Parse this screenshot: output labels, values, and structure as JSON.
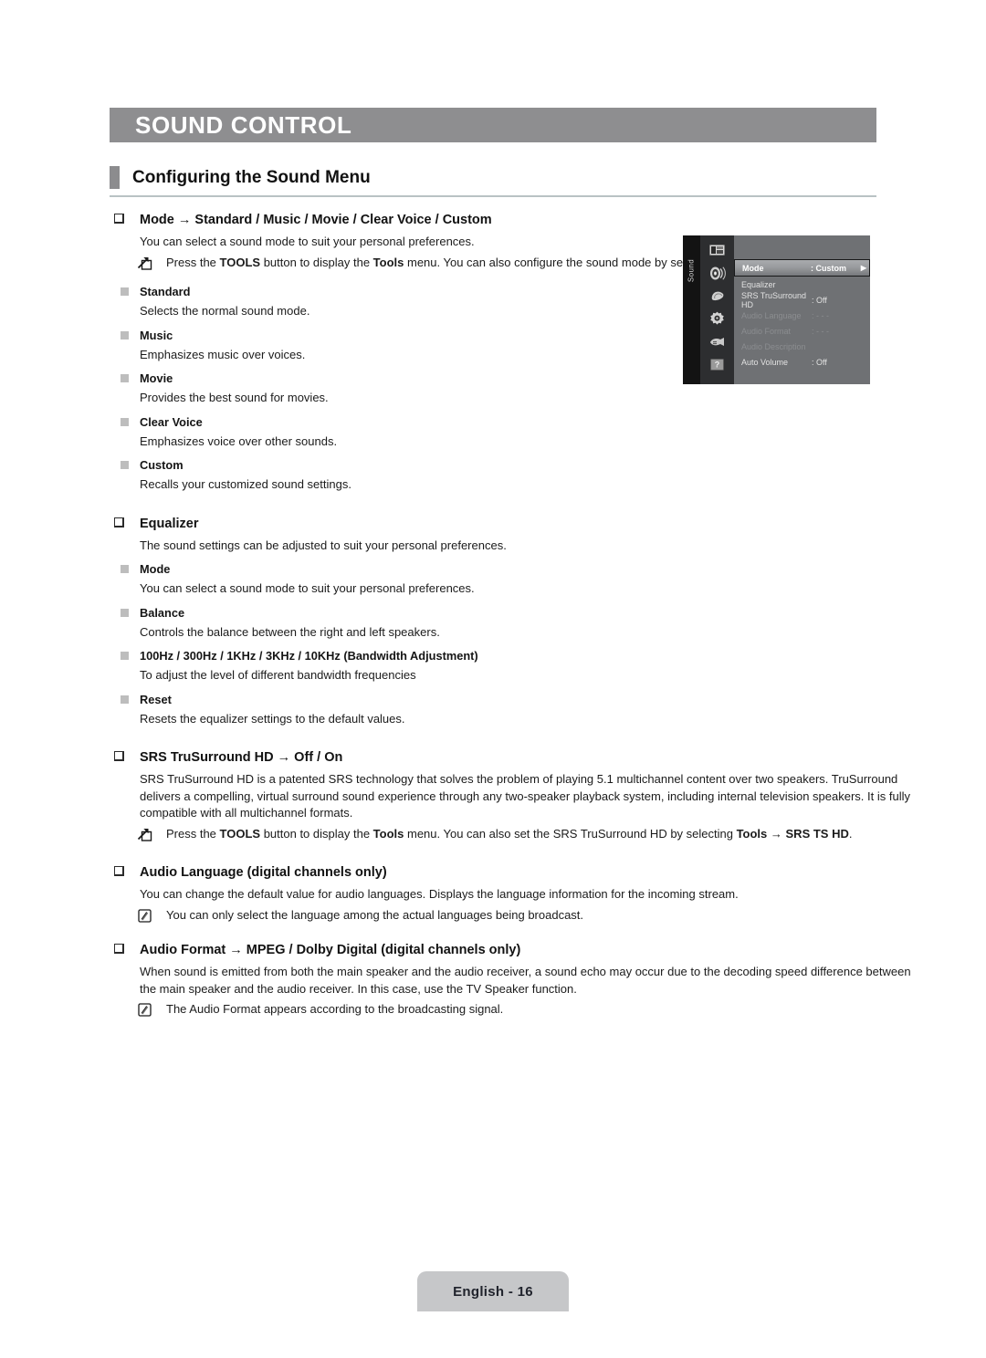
{
  "chapter": {
    "title": "SOUND CONTROL"
  },
  "section": {
    "title": "Configuring the Sound Menu"
  },
  "blocks": {
    "mode": {
      "heading": "Mode → Standard / Music / Movie / Clear Voice / Custom",
      "intro": "You can select a sound mode to suit your personal preferences.",
      "tools_note_html": "Press the <b class=\"sb\">TOOLS</b> button to display the <b class=\"sb\">Tools</b> menu. You can also configure the sound mode by selecting <b class=\"sb\">Tools</b> → <b class=\"sb\">Sound Mode</b>.",
      "items": [
        {
          "label": "Standard",
          "desc": "Selects the normal sound mode."
        },
        {
          "label": "Music",
          "desc": "Emphasizes music over voices."
        },
        {
          "label": "Movie",
          "desc": "Provides the best sound for movies."
        },
        {
          "label": "Clear Voice",
          "desc": "Emphasizes voice over other sounds."
        },
        {
          "label": "Custom",
          "desc": "Recalls your customized sound settings."
        }
      ]
    },
    "equalizer": {
      "heading": "Equalizer",
      "intro": "The sound settings can be adjusted to suit your personal preferences.",
      "items": [
        {
          "label": "Mode",
          "desc": "You can select a sound mode to suit your personal preferences."
        },
        {
          "label": "Balance",
          "desc": "Controls the balance between the right and left speakers."
        },
        {
          "label": "100Hz / 300Hz / 1KHz / 3KHz / 10KHz (Bandwidth Adjustment)",
          "desc": "To adjust the level of different bandwidth frequencies"
        },
        {
          "label": "Reset",
          "desc": "Resets the equalizer settings to the default values."
        }
      ]
    },
    "srs": {
      "heading": "SRS TruSurround HD → Off / On",
      "body": "SRS TruSurround HD is a patented SRS technology that solves the problem of playing 5.1 multichannel content over two speakers. TruSurround delivers a compelling, virtual surround sound experience through any two-speaker playback system, including internal television speakers. It is fully compatible with all multichannel formats.",
      "tools_note_html": "Press the <b class=\"sb\">TOOLS</b> button to display the <b class=\"sb\">Tools</b> menu. You can also set the SRS TruSurround HD by selecting <b class=\"sb\">Tools</b> → <b class=\"sb\">SRS TS HD</b>."
    },
    "audio_language": {
      "heading": "Audio Language (digital channels only)",
      "body": "You can change the default value for audio languages. Displays the language information for the incoming stream.",
      "note": "You can only select the language among the actual languages being broadcast."
    },
    "audio_format": {
      "heading": "Audio Format → MPEG / Dolby Digital (digital channels only)",
      "body": "When sound is emitted from both the main speaker and the audio receiver, a sound echo may occur due to the decoding speed difference between the main speaker and the audio receiver. In this case, use the TV Speaker function.",
      "note": "The Audio Format appears according to the broadcasting signal."
    }
  },
  "osd": {
    "vertical_label": "Sound",
    "icons": [
      "picture-icon",
      "sound-icon",
      "channel-icon",
      "setup-icon",
      "input-icon",
      "support-icon"
    ],
    "rows": [
      {
        "label": "Mode",
        "value": ": Custom",
        "arrow": "▶",
        "selected": true,
        "dim": false
      },
      {
        "label": "Equalizer",
        "value": "",
        "arrow": "",
        "selected": false,
        "dim": false
      },
      {
        "label": "SRS TruSurround HD",
        "value": ": Off",
        "arrow": "",
        "selected": false,
        "dim": false
      },
      {
        "label": "Audio Language",
        "value": ": - - -",
        "arrow": "",
        "selected": false,
        "dim": true
      },
      {
        "label": "Audio Format",
        "value": ": - - -",
        "arrow": "",
        "selected": false,
        "dim": true
      },
      {
        "label": "Audio Description",
        "value": "",
        "arrow": "",
        "selected": false,
        "dim": true
      },
      {
        "label": "Auto Volume",
        "value": ": Off",
        "arrow": "",
        "selected": false,
        "dim": false
      }
    ]
  },
  "footer": {
    "page_label": "English - 16"
  },
  "colors": {
    "chapter_bar": "#8e8e90",
    "section_marker": "#8c8c8e",
    "section_rule": "#b9c2c4",
    "bullet_fill": "#bdbdbd",
    "osd_bg": "#6f7174",
    "footer_tab": "#c6c7c9"
  }
}
